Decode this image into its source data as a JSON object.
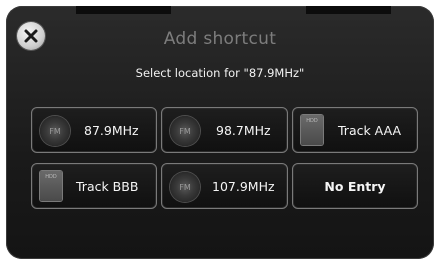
{
  "dialog": {
    "title": "Add shortcut",
    "subtitle": "Select location for \"87.9MHz\""
  },
  "tiles": [
    {
      "label": "87.9MHz",
      "icon": "fm-icon"
    },
    {
      "label": "98.7MHz",
      "icon": "fm-icon"
    },
    {
      "label": "Track AAA",
      "icon": "hdd-icon"
    },
    {
      "label": "Track BBB",
      "icon": "hdd-icon"
    },
    {
      "label": "107.9MHz",
      "icon": "fm-icon"
    },
    {
      "label": "No Entry",
      "icon": ""
    }
  ],
  "icons": {
    "fm_text": "FM",
    "hdd_text": "HDD",
    "close": "close-icon"
  }
}
